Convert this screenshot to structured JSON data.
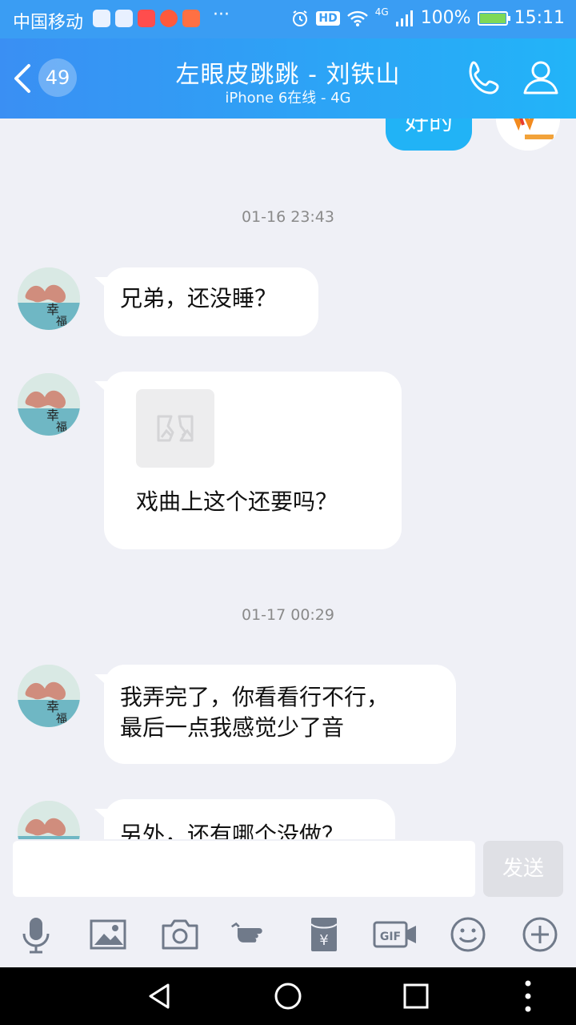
{
  "status_bar": {
    "carrier": "中国移动",
    "more": "···",
    "hd": "HD",
    "network": "4G",
    "battery": "100%",
    "battery_level": 1.0,
    "time": "15:11"
  },
  "header": {
    "back_badge": "49",
    "title": "左眼皮跳跳 - 刘铁山",
    "subtitle": "iPhone 6在线 - 4G"
  },
  "chat": {
    "top_bubble": "好的",
    "timestamps": [
      "01-16 23:43",
      "01-17 00:29"
    ],
    "messages": [
      {
        "text": "兄弟，还没睡？"
      },
      {
        "text": "戏曲上这个还要吗？"
      },
      {
        "line1": "我弄完了，你看看行不行，",
        "line2": "最后一点我感觉少了音"
      },
      {
        "text": "另外，还有哪个没做？"
      }
    ]
  },
  "input": {
    "value": "",
    "send_label": "发送"
  },
  "toolbar": {
    "gif": "GIF",
    "yuan": "¥"
  },
  "colors": {
    "header_start": "#3a8ff3",
    "header_end": "#22b4f8",
    "my_bubble": "#21b3f6",
    "chat_bg": "#eff0f6"
  },
  "icons": [
    "back-chevron-icon",
    "phone-icon",
    "profile-icon",
    "microphone-icon",
    "image-icon",
    "camera-icon",
    "poke-hand-icon",
    "red-packet-icon",
    "gif-icon",
    "emoji-icon",
    "plus-icon",
    "nav-back-icon",
    "nav-home-icon",
    "nav-recents-icon",
    "nav-menu-icon"
  ]
}
